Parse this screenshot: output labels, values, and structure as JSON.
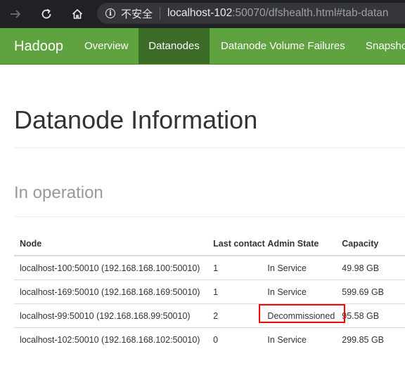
{
  "browser": {
    "security_label": "不安全",
    "url_host": "localhost-102",
    "url_rest": ":50070/dfshealth.html#tab-datan"
  },
  "navbar": {
    "brand": "Hadoop",
    "items": [
      {
        "label": "Overview"
      },
      {
        "label": "Datanodes"
      },
      {
        "label": "Datanode Volume Failures"
      },
      {
        "label": "Snapsho"
      }
    ],
    "active_index": 1,
    "colors": {
      "bar": "#5fa341",
      "active": "#3d6b28"
    }
  },
  "page": {
    "title": "Datanode Information",
    "section": "In operation"
  },
  "table": {
    "headers": [
      "Node",
      "Last contact",
      "Admin State",
      "Capacity"
    ],
    "rows": [
      {
        "node": "localhost-100:50010 (192.168.168.100:50010)",
        "last_contact": "1",
        "admin_state": "In Service",
        "capacity": "49.98 GB"
      },
      {
        "node": "localhost-169:50010 (192.168.168.169:50010)",
        "last_contact": "1",
        "admin_state": "In Service",
        "capacity": "599.69 GB"
      },
      {
        "node": "localhost-99:50010 (192.168.168.99:50010)",
        "last_contact": "2",
        "admin_state": "Decommissioned",
        "capacity": "95.58 GB"
      },
      {
        "node": "localhost-102:50010 (192.168.168.102:50010)",
        "last_contact": "0",
        "admin_state": "In Service",
        "capacity": "299.85 GB"
      }
    ],
    "highlight_color": "#ff0000"
  },
  "icons": {
    "forward": "forward-arrow-icon",
    "reload": "reload-icon",
    "home": "home-icon",
    "info": "info-icon"
  }
}
